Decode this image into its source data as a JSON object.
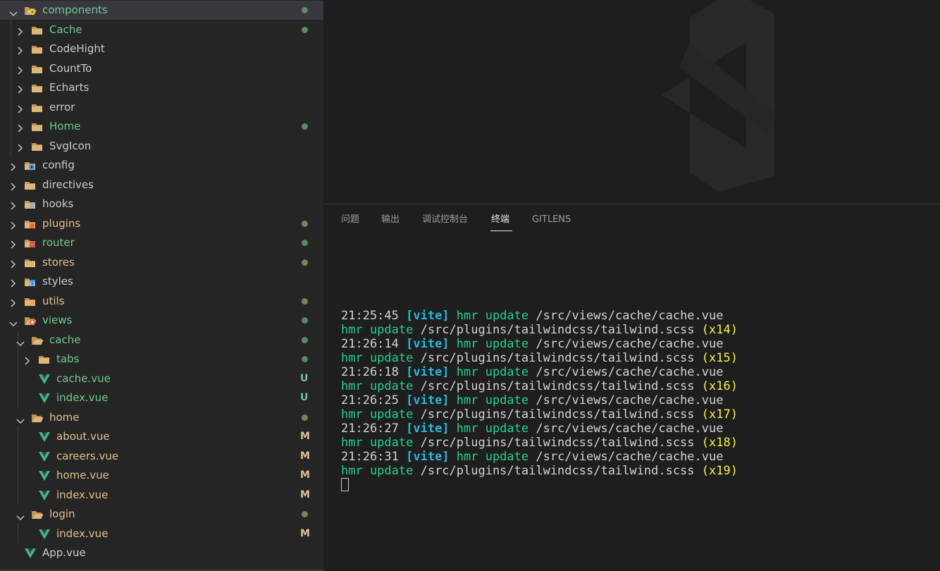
{
  "explorer": {
    "rows": [
      {
        "label": "components",
        "depth": 0,
        "type": "folder-open",
        "icon": "components-folder-icon",
        "color": "#73c991",
        "deco": "dot",
        "deco_color": "#5a8a63",
        "selected": true
      },
      {
        "label": "Cache",
        "depth": 1,
        "type": "folder",
        "icon": "folder-icon",
        "color": "#73c991",
        "deco": "dot",
        "deco_color": "#5a8a63"
      },
      {
        "label": "CodeHight",
        "depth": 1,
        "type": "folder",
        "icon": "folder-icon",
        "color": "#cccccc"
      },
      {
        "label": "CountTo",
        "depth": 1,
        "type": "folder",
        "icon": "folder-icon",
        "color": "#cccccc"
      },
      {
        "label": "Echarts",
        "depth": 1,
        "type": "folder",
        "icon": "folder-icon",
        "color": "#cccccc"
      },
      {
        "label": "error",
        "depth": 1,
        "type": "folder",
        "icon": "folder-icon",
        "color": "#cccccc"
      },
      {
        "label": "Home",
        "depth": 1,
        "type": "folder",
        "icon": "folder-icon",
        "color": "#73c991",
        "deco": "dot",
        "deco_color": "#5a8a63"
      },
      {
        "label": "SvgIcon",
        "depth": 1,
        "type": "folder",
        "icon": "folder-icon",
        "color": "#cccccc"
      },
      {
        "label": "config",
        "depth": 0,
        "type": "folder",
        "icon": "config-folder-icon",
        "color": "#cccccc"
      },
      {
        "label": "directives",
        "depth": 0,
        "type": "folder",
        "icon": "folder-icon",
        "color": "#cccccc"
      },
      {
        "label": "hooks",
        "depth": 0,
        "type": "folder",
        "icon": "hooks-folder-icon",
        "color": "#cccccc"
      },
      {
        "label": "plugins",
        "depth": 0,
        "type": "folder",
        "icon": "plugins-folder-icon",
        "color": "#e2c08d",
        "deco": "dot",
        "deco_color": "#8a7a5c"
      },
      {
        "label": "router",
        "depth": 0,
        "type": "folder",
        "icon": "router-folder-icon",
        "color": "#73c991",
        "deco": "dot",
        "deco_color": "#5a8a63"
      },
      {
        "label": "stores",
        "depth": 0,
        "type": "folder",
        "icon": "folder-icon",
        "color": "#e2c08d",
        "deco": "dot",
        "deco_color": "#8a7a5c"
      },
      {
        "label": "styles",
        "depth": 0,
        "type": "folder",
        "icon": "styles-folder-icon",
        "color": "#cccccc"
      },
      {
        "label": "utils",
        "depth": 0,
        "type": "folder",
        "icon": "utils-folder-icon",
        "color": "#e2c08d",
        "deco": "dot",
        "deco_color": "#8a7a5c"
      },
      {
        "label": "views",
        "depth": 0,
        "type": "folder-open",
        "icon": "views-folder-icon",
        "color": "#73c991",
        "deco": "dot",
        "deco_color": "#5a8a63"
      },
      {
        "label": "cache",
        "depth": 1,
        "type": "folder-open",
        "icon": "folder-open-icon",
        "color": "#73c991",
        "deco": "dot",
        "deco_color": "#5a8a63"
      },
      {
        "label": "tabs",
        "depth": 2,
        "type": "folder",
        "icon": "folder-icon",
        "color": "#73c991",
        "deco": "dot",
        "deco_color": "#5a8a63"
      },
      {
        "label": "cache.vue",
        "depth": 2,
        "type": "file",
        "icon": "vue-file-icon",
        "color": "#73c991",
        "deco": "U",
        "deco_color": "#73c991"
      },
      {
        "label": "index.vue",
        "depth": 2,
        "type": "file",
        "icon": "vue-file-icon",
        "color": "#73c991",
        "deco": "U",
        "deco_color": "#73c991"
      },
      {
        "label": "home",
        "depth": 1,
        "type": "folder-open",
        "icon": "folder-open-icon",
        "color": "#e2c08d",
        "deco": "dot",
        "deco_color": "#8a7a5c"
      },
      {
        "label": "about.vue",
        "depth": 2,
        "type": "file",
        "icon": "vue-file-icon",
        "color": "#e2c08d",
        "deco": "M",
        "deco_color": "#e2c08d"
      },
      {
        "label": "careers.vue",
        "depth": 2,
        "type": "file",
        "icon": "vue-file-icon",
        "color": "#e2c08d",
        "deco": "M",
        "deco_color": "#e2c08d"
      },
      {
        "label": "home.vue",
        "depth": 2,
        "type": "file",
        "icon": "vue-file-icon",
        "color": "#e2c08d",
        "deco": "M",
        "deco_color": "#e2c08d"
      },
      {
        "label": "index.vue",
        "depth": 2,
        "type": "file",
        "icon": "vue-file-icon",
        "color": "#e2c08d",
        "deco": "M",
        "deco_color": "#e2c08d"
      },
      {
        "label": "login",
        "depth": 1,
        "type": "folder-open",
        "icon": "folder-open-icon",
        "color": "#e2c08d",
        "deco": "dot",
        "deco_color": "#8a7a5c"
      },
      {
        "label": "index.vue",
        "depth": 2,
        "type": "file",
        "icon": "vue-file-icon",
        "color": "#e2c08d",
        "deco": "M",
        "deco_color": "#e2c08d"
      },
      {
        "label": "App.vue",
        "depth": 0,
        "type": "file",
        "icon": "vue-file-icon",
        "color": "#cccccc"
      }
    ]
  },
  "panel": {
    "tabs": [
      {
        "label": "问题",
        "name": "tab-problems"
      },
      {
        "label": "输出",
        "name": "tab-output"
      },
      {
        "label": "调试控制台",
        "name": "tab-debug-console"
      },
      {
        "label": "终端",
        "name": "tab-terminal",
        "active": true
      },
      {
        "label": "GITLENS",
        "name": "tab-gitlens"
      }
    ]
  },
  "terminal": {
    "lines": [
      [
        {
          "t": "21:25:45 ",
          "c": "time"
        },
        {
          "t": "[vite] ",
          "c": "vite"
        },
        {
          "t": "hmr update ",
          "c": "hmr"
        },
        {
          "t": "/src/views/cache/cache.vue",
          "c": "path"
        }
      ],
      [
        {
          "t": "hmr update ",
          "c": "hmr"
        },
        {
          "t": "/src/plugins/tailwindcss/tailwind.scss ",
          "c": "path"
        },
        {
          "t": "(x14)",
          "c": "count"
        }
      ],
      [
        {
          "t": "21:26:14 ",
          "c": "time"
        },
        {
          "t": "[vite] ",
          "c": "vite"
        },
        {
          "t": "hmr update ",
          "c": "hmr"
        },
        {
          "t": "/src/views/cache/cache.vue",
          "c": "path"
        }
      ],
      [
        {
          "t": "hmr update ",
          "c": "hmr"
        },
        {
          "t": "/src/plugins/tailwindcss/tailwind.scss ",
          "c": "path"
        },
        {
          "t": "(x15)",
          "c": "count"
        }
      ],
      [
        {
          "t": "21:26:18 ",
          "c": "time"
        },
        {
          "t": "[vite] ",
          "c": "vite"
        },
        {
          "t": "hmr update ",
          "c": "hmr"
        },
        {
          "t": "/src/views/cache/cache.vue",
          "c": "path"
        }
      ],
      [
        {
          "t": "hmr update ",
          "c": "hmr"
        },
        {
          "t": "/src/plugins/tailwindcss/tailwind.scss ",
          "c": "path"
        },
        {
          "t": "(x16)",
          "c": "count"
        }
      ],
      [
        {
          "t": "21:26:25 ",
          "c": "time"
        },
        {
          "t": "[vite] ",
          "c": "vite"
        },
        {
          "t": "hmr update ",
          "c": "hmr"
        },
        {
          "t": "/src/views/cache/cache.vue",
          "c": "path"
        }
      ],
      [
        {
          "t": "hmr update ",
          "c": "hmr"
        },
        {
          "t": "/src/plugins/tailwindcss/tailwind.scss ",
          "c": "path"
        },
        {
          "t": "(x17)",
          "c": "count"
        }
      ],
      [
        {
          "t": "21:26:27 ",
          "c": "time"
        },
        {
          "t": "[vite] ",
          "c": "vite"
        },
        {
          "t": "hmr update ",
          "c": "hmr"
        },
        {
          "t": "/src/views/cache/cache.vue",
          "c": "path"
        }
      ],
      [
        {
          "t": "hmr update ",
          "c": "hmr"
        },
        {
          "t": "/src/plugins/tailwindcss/tailwind.scss ",
          "c": "path"
        },
        {
          "t": "(x18)",
          "c": "count"
        }
      ],
      [
        {
          "t": "21:26:31 ",
          "c": "time"
        },
        {
          "t": "[vite] ",
          "c": "vite"
        },
        {
          "t": "hmr update ",
          "c": "hmr"
        },
        {
          "t": "/src/views/cache/cache.vue",
          "c": "path"
        }
      ],
      [
        {
          "t": "hmr update ",
          "c": "hmr"
        },
        {
          "t": "/src/plugins/tailwindcss/tailwind.scss ",
          "c": "path"
        },
        {
          "t": "(x19)",
          "c": "count"
        }
      ]
    ]
  }
}
